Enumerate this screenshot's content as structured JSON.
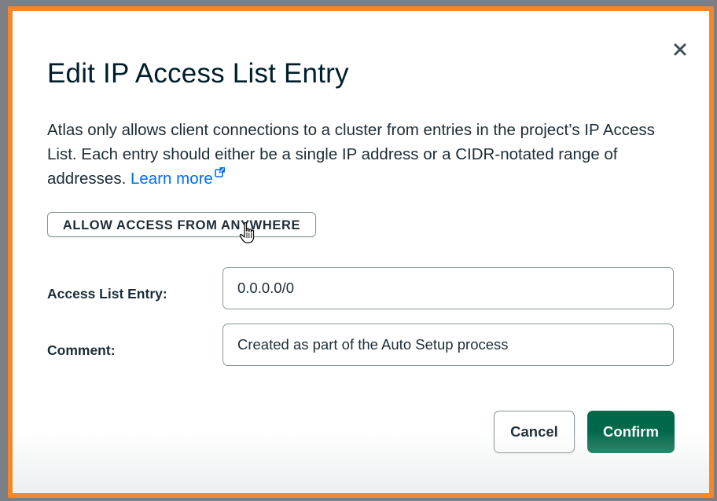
{
  "modal": {
    "title": "Edit IP Access List Entry",
    "description": "Atlas only allows client connections to a cluster from entries in the project’s IP Access List. Each entry should either be a single IP address or a CIDR-notated range of addresses.",
    "learn_more_label": "Learn more",
    "allow_anywhere_label": "ALLOW ACCESS FROM ANYWHERE",
    "fields": {
      "access_list_entry": {
        "label": "Access List Entry:",
        "value": "0.0.0.0/0"
      },
      "comment": {
        "label": "Comment:",
        "value": "Created as part of the Auto Setup process"
      }
    },
    "buttons": {
      "cancel_label": "Cancel",
      "confirm_label": "Confirm"
    },
    "icons": {
      "close": "close-icon",
      "external_link": "external-link-icon",
      "cursor": "hand-pointer-icon"
    }
  },
  "colors": {
    "frame_border": "#f5862a",
    "title": "#001e2b",
    "link": "#016bf8",
    "confirm_bg": "#00684a",
    "text": "#1c2d38"
  }
}
